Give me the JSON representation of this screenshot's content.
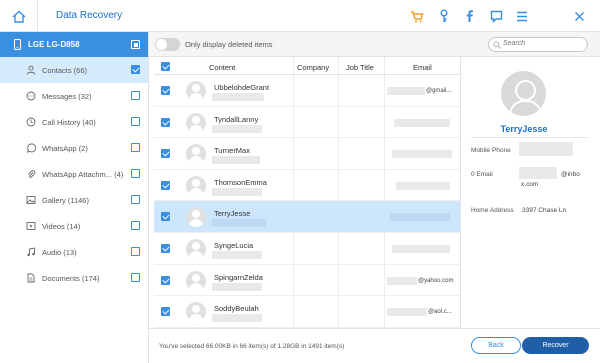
{
  "app": {
    "title": "Data Recovery"
  },
  "colors": {
    "accent": "#3b8fe0",
    "selected_row": "#cde6fb",
    "recover_button": "#1f5fa8",
    "cart_icon": "#f0a020"
  },
  "titlebar_icons": [
    "home-icon",
    "cart-icon",
    "key-icon",
    "facebook-icon",
    "feedback-icon",
    "menu-icon",
    "close-icon"
  ],
  "sidebar": {
    "device": "LGE LG-D858",
    "items": [
      {
        "label": "Contacts (66)",
        "icon": "contacts-icon",
        "checked": true,
        "active": true
      },
      {
        "label": "Messages (32)",
        "icon": "messages-icon",
        "checked": false
      },
      {
        "label": "Call History (40)",
        "icon": "call-history-icon",
        "checked": false
      },
      {
        "label": "WhatsApp (2)",
        "icon": "whatsapp-icon",
        "checked": false
      },
      {
        "label": "WhatsApp Attachm... (4)",
        "icon": "whatsapp-attachments-icon",
        "checked": false
      },
      {
        "label": "Gallery (1146)",
        "icon": "gallery-icon",
        "checked": false
      },
      {
        "label": "Videos (14)",
        "icon": "videos-icon",
        "checked": false
      },
      {
        "label": "Audio (13)",
        "icon": "audio-icon",
        "checked": false
      },
      {
        "label": "Documents (174)",
        "icon": "documents-icon",
        "checked": false
      }
    ]
  },
  "toolbar": {
    "toggle_label": "Only display deleted items",
    "search_placeholder": "Search"
  },
  "table": {
    "headers": {
      "content": "Content",
      "company": "Company",
      "job_title": "Job Title",
      "email": "Email"
    },
    "rows": [
      {
        "name": "UbbelohdeGrant",
        "email_suffix": "@gmail...",
        "selected": false
      },
      {
        "name": "TyndallLanny",
        "email_suffix": "",
        "selected": false
      },
      {
        "name": "TurnerMax",
        "email_suffix": "",
        "selected": false
      },
      {
        "name": "ThomsonEmma",
        "email_suffix": "",
        "selected": false
      },
      {
        "name": "TerryJesse",
        "email_suffix": "",
        "selected": true
      },
      {
        "name": "SyngeLucia",
        "email_suffix": "",
        "selected": false
      },
      {
        "name": "SpingarnZelda",
        "email_suffix": "@yahoo.com",
        "selected": false
      },
      {
        "name": "SoddyBeulah",
        "email_suffix": "@aol.c...",
        "selected": false
      }
    ]
  },
  "detail": {
    "name": "TerryJesse",
    "mobile_label": "Mobile Phone",
    "email_label": "0 Email",
    "email_part1": "@inbo",
    "email_part2": "x.com",
    "address_label": "Home Address",
    "address_value": "3397 Chase Ln"
  },
  "footer": {
    "status": "You've selected 66.00KB in 66 item(s) of 1.28GB in 1491 item(s)",
    "back_label": "Back",
    "recover_label": "Recover"
  }
}
